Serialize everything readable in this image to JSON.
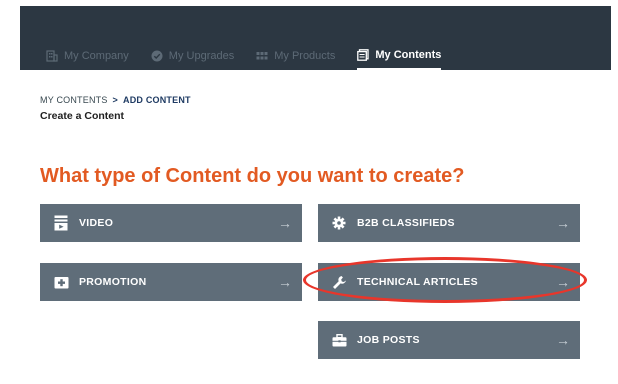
{
  "nav": {
    "items": [
      {
        "label": "My Company",
        "icon": "building-icon"
      },
      {
        "label": "My Upgrades",
        "icon": "badge-icon"
      },
      {
        "label": "My Products",
        "icon": "grid-icon"
      },
      {
        "label": "My Contents",
        "icon": "document-icon"
      }
    ],
    "active_index": 3
  },
  "breadcrumb": {
    "root": "MY CONTENTS",
    "separator": ">",
    "current": "ADD CONTENT"
  },
  "page_subtitle": "Create a Content",
  "headline": "What type of Content do you want to create?",
  "tiles": [
    {
      "label": "VIDEO",
      "icon": "video-icon",
      "arrow": "→"
    },
    {
      "label": "B2B CLASSIFIEDS",
      "icon": "gear-icon",
      "arrow": "→"
    },
    {
      "label": "PROMOTION",
      "icon": "medical-kit-icon",
      "arrow": "→"
    },
    {
      "label": "TECHNICAL ARTICLES",
      "icon": "wrench-icon",
      "arrow": "→"
    },
    {
      "label": "JOB POSTS",
      "icon": "briefcase-icon",
      "arrow": "→"
    }
  ],
  "colors": {
    "topbar": "#2c3742",
    "tile": "#5f6d79",
    "headline": "#e25a22",
    "highlight": "#e8362b",
    "breadcrumb_current": "#1f3b63"
  }
}
